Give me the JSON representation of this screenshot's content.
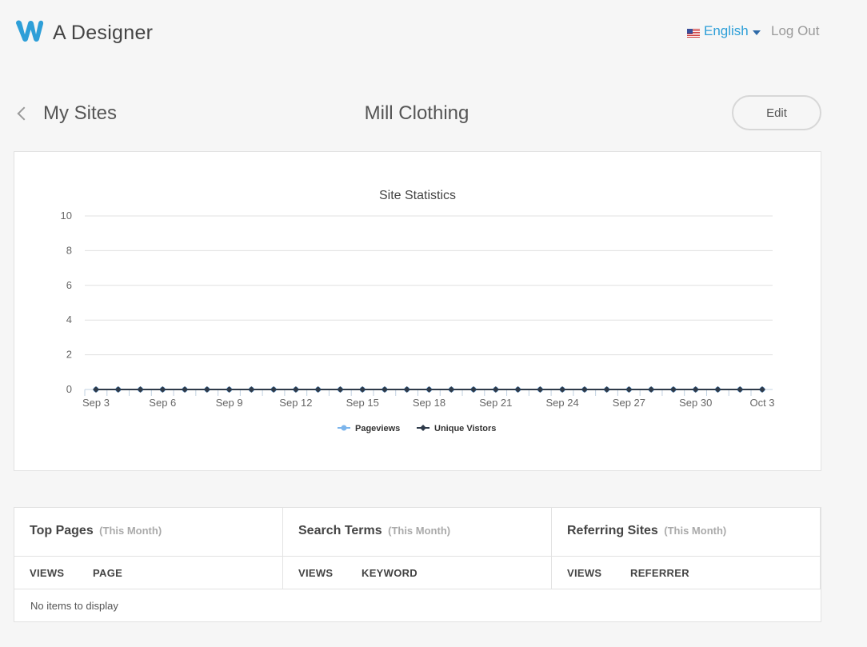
{
  "header": {
    "brand": "A Designer",
    "language": "English",
    "logout": "Log Out",
    "logo_icon": "weebly-w-logo",
    "flag_icon": "us-flag-icon"
  },
  "titlebar": {
    "back_label": "My Sites",
    "site_title": "Mill Clothing",
    "edit_label": "Edit"
  },
  "chart_data": {
    "type": "line",
    "title": "Site Statistics",
    "x": [
      "Sep 3",
      "Sep 4",
      "Sep 5",
      "Sep 6",
      "Sep 7",
      "Sep 8",
      "Sep 9",
      "Sep 10",
      "Sep 11",
      "Sep 12",
      "Sep 13",
      "Sep 14",
      "Sep 15",
      "Sep 16",
      "Sep 17",
      "Sep 18",
      "Sep 19",
      "Sep 20",
      "Sep 21",
      "Sep 22",
      "Sep 23",
      "Sep 24",
      "Sep 25",
      "Sep 26",
      "Sep 27",
      "Sep 28",
      "Sep 29",
      "Sep 30",
      "Oct 1",
      "Oct 2",
      "Oct 3"
    ],
    "x_tick_labels": [
      "Sep 3",
      "Sep 6",
      "Sep 9",
      "Sep 12",
      "Sep 15",
      "Sep 18",
      "Sep 21",
      "Sep 24",
      "Sep 27",
      "Sep 30",
      "Oct 3"
    ],
    "series": [
      {
        "name": "Pageviews",
        "color": "#7cb5ec",
        "values": [
          0,
          0,
          0,
          0,
          0,
          0,
          0,
          0,
          0,
          0,
          0,
          0,
          0,
          0,
          0,
          0,
          0,
          0,
          0,
          0,
          0,
          0,
          0,
          0,
          0,
          0,
          0,
          0,
          0,
          0,
          0
        ]
      },
      {
        "name": "Unique Vistors",
        "color": "#2f3b4a",
        "values": [
          0,
          0,
          0,
          0,
          0,
          0,
          0,
          0,
          0,
          0,
          0,
          0,
          0,
          0,
          0,
          0,
          0,
          0,
          0,
          0,
          0,
          0,
          0,
          0,
          0,
          0,
          0,
          0,
          0,
          0,
          0
        ]
      }
    ],
    "ylim": [
      0,
      10
    ],
    "y_ticks": [
      0,
      2,
      4,
      6,
      8,
      10
    ],
    "grid": true,
    "legend": "bottom-center"
  },
  "tables": [
    {
      "title": "Top Pages",
      "subtitle": "(This Month)",
      "col1": "VIEWS",
      "col2": "PAGE"
    },
    {
      "title": "Search Terms",
      "subtitle": "(This Month)",
      "col1": "VIEWS",
      "col2": "KEYWORD"
    },
    {
      "title": "Referring Sites",
      "subtitle": "(This Month)",
      "col1": "VIEWS",
      "col2": "REFERRER"
    }
  ],
  "empty_message": "No items to display"
}
